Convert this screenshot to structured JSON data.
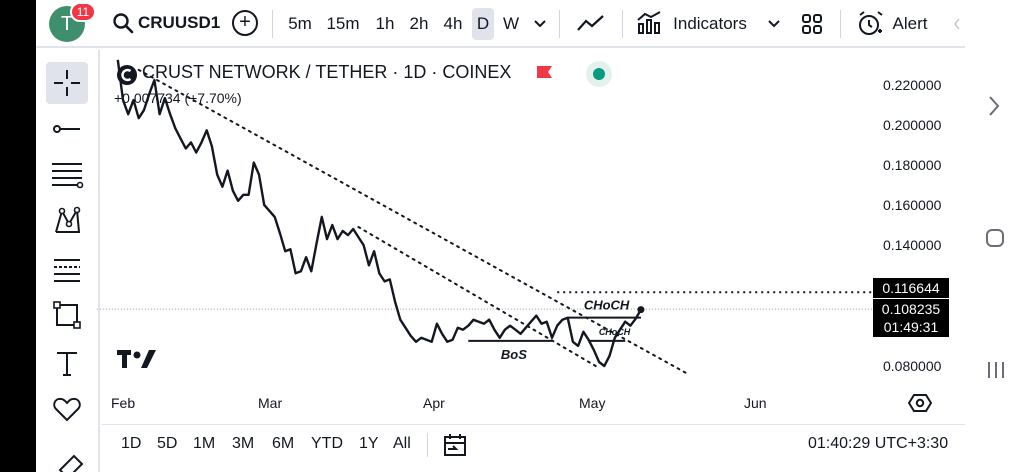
{
  "header": {
    "avatar_letter": "T",
    "notification_count": "11",
    "symbol": "CRUUSD1",
    "timeframes": [
      "5m",
      "15m",
      "1h",
      "2h",
      "4h",
      "D",
      "W"
    ],
    "active_timeframe": "D",
    "indicators_label": "Indicators",
    "alert_label": "Alert"
  },
  "legend": {
    "title": "CRUST NETWORK / TETHER · 1D · COINEX",
    "change": "+0.007734 (+7.70%)",
    "status_color": "#089981",
    "flag_color": "#f23645"
  },
  "price_tags": {
    "dotted_level": "0.116644",
    "last_price": "0.108235",
    "countdown": "01:49:31"
  },
  "annotations": {
    "choch_top": "CHoCH",
    "choch_small": "CHoCH",
    "bos": "BoS"
  },
  "bottom": {
    "ranges": [
      "1D",
      "5D",
      "1M",
      "3M",
      "6M",
      "YTD",
      "1Y",
      "All"
    ],
    "clock": "01:40:29 UTC+3:30"
  },
  "chart_data": {
    "type": "line",
    "title": "CRUST NETWORK / TETHER · 1D · COINEX",
    "x_ticks": [
      "Feb",
      "Mar",
      "Apr",
      "May",
      "Jun"
    ],
    "y_ticks": [
      "0.220000",
      "0.200000",
      "0.180000",
      "0.160000",
      "0.140000",
      "0.080000"
    ],
    "ylim": [
      0.07,
      0.235
    ],
    "grid": false,
    "series": [
      {
        "values": [
          [
            "01-31",
            0.232
          ],
          [
            "02-01",
            0.212
          ],
          [
            "02-02",
            0.205
          ],
          [
            "02-03",
            0.212
          ],
          [
            "02-04",
            0.203
          ],
          [
            "02-05",
            0.207
          ],
          [
            "02-06",
            0.215
          ],
          [
            "02-07",
            0.222
          ],
          [
            "02-08",
            0.205
          ],
          [
            "02-09",
            0.213
          ],
          [
            "02-10",
            0.205
          ],
          [
            "02-11",
            0.198
          ],
          [
            "02-12",
            0.193
          ],
          [
            "02-13",
            0.188
          ],
          [
            "02-14",
            0.191
          ],
          [
            "02-15",
            0.186
          ],
          [
            "02-16",
            0.191
          ],
          [
            "02-17",
            0.197
          ],
          [
            "02-18",
            0.189
          ],
          [
            "02-19",
            0.175
          ],
          [
            "02-20",
            0.169
          ],
          [
            "02-21",
            0.177
          ],
          [
            "02-22",
            0.167
          ],
          [
            "02-23",
            0.162
          ],
          [
            "02-24",
            0.165
          ],
          [
            "02-25",
            0.165
          ],
          [
            "02-26",
            0.181
          ],
          [
            "02-27",
            0.175
          ],
          [
            "02-28",
            0.16
          ],
          [
            "03-01",
            0.154
          ],
          [
            "03-02",
            0.146
          ],
          [
            "03-03",
            0.137
          ],
          [
            "03-04",
            0.138
          ],
          [
            "03-05",
            0.126
          ],
          [
            "03-06",
            0.127
          ],
          [
            "03-07",
            0.134
          ],
          [
            "03-08",
            0.127
          ],
          [
            "03-09",
            0.141
          ],
          [
            "03-10",
            0.154
          ],
          [
            "03-11",
            0.143
          ],
          [
            "03-12",
            0.15
          ],
          [
            "03-13",
            0.143
          ],
          [
            "03-14",
            0.147
          ],
          [
            "03-15",
            0.145
          ],
          [
            "03-16",
            0.148
          ],
          [
            "03-17",
            0.144
          ],
          [
            "03-18",
            0.14
          ],
          [
            "03-19",
            0.13
          ],
          [
            "03-20",
            0.137
          ],
          [
            "03-21",
            0.126
          ],
          [
            "03-22",
            0.122
          ],
          [
            "03-23",
            0.123
          ],
          [
            "03-24",
            0.112
          ],
          [
            "03-25",
            0.103
          ],
          [
            "03-26",
            0.099
          ],
          [
            "03-27",
            0.095
          ],
          [
            "03-28",
            0.092
          ],
          [
            "03-29",
            0.094
          ],
          [
            "03-30",
            0.093
          ],
          [
            "03-31",
            0.092
          ],
          [
            "04-01",
            0.101
          ],
          [
            "04-02",
            0.096
          ],
          [
            "04-03",
            0.092
          ],
          [
            "04-04",
            0.093
          ],
          [
            "04-05",
            0.099
          ],
          [
            "04-06",
            0.098
          ],
          [
            "04-07",
            0.1
          ],
          [
            "04-08",
            0.103
          ],
          [
            "04-09",
            0.102
          ],
          [
            "04-10",
            0.101
          ],
          [
            "04-11",
            0.103
          ],
          [
            "04-12",
            0.098
          ],
          [
            "04-13",
            0.094
          ],
          [
            "04-14",
            0.098
          ],
          [
            "04-15",
            0.1
          ],
          [
            "04-16",
            0.098
          ],
          [
            "04-17",
            0.096
          ],
          [
            "04-18",
            0.099
          ],
          [
            "04-19",
            0.102
          ],
          [
            "04-20",
            0.105
          ],
          [
            "04-21",
            0.101
          ],
          [
            "04-22",
            0.102
          ],
          [
            "04-23",
            0.094
          ],
          [
            "04-24",
            0.1
          ],
          [
            "04-25",
            0.103
          ],
          [
            "04-26",
            0.104
          ],
          [
            "04-27",
            0.092
          ],
          [
            "04-28",
            0.09
          ],
          [
            "04-29",
            0.097
          ],
          [
            "04-30",
            0.093
          ],
          [
            "05-01",
            0.088
          ],
          [
            "05-02",
            0.082
          ],
          [
            "05-03",
            0.08
          ],
          [
            "05-04",
            0.085
          ],
          [
            "05-05",
            0.094
          ],
          [
            "05-06",
            0.098
          ],
          [
            "05-07",
            0.102
          ],
          [
            "05-08",
            0.1
          ],
          [
            "05-09",
            0.1035
          ],
          [
            "05-10",
            0.108
          ]
        ]
      }
    ],
    "x_range": [
      "01-27",
      "06-25"
    ],
    "trendlines": [
      {
        "from": [
          "02-04",
          0.227
        ],
        "to": [
          "05-19",
          0.076
        ],
        "style": "dotted"
      },
      {
        "from": [
          "03-17",
          0.149
        ],
        "to": [
          "05-02",
          0.079
        ],
        "style": "dotted"
      }
    ],
    "levels": [
      {
        "label": "CHoCH",
        "y": 0.104,
        "from": "04-26",
        "to": "05-10",
        "style": "solid"
      },
      {
        "label": "CHoCH",
        "y": 0.0925,
        "from": "04-30",
        "to": "05-07",
        "style": "solid"
      },
      {
        "label": "BoS",
        "y": 0.0925,
        "from": "04-07",
        "to": "04-23",
        "style": "solid"
      },
      {
        "y": 0.116644,
        "from": "04-24",
        "to": "06-25",
        "style": "dotted"
      },
      {
        "y": 0.108235,
        "from": "01-27",
        "to": "06-25",
        "style": "dotted-light"
      }
    ]
  }
}
